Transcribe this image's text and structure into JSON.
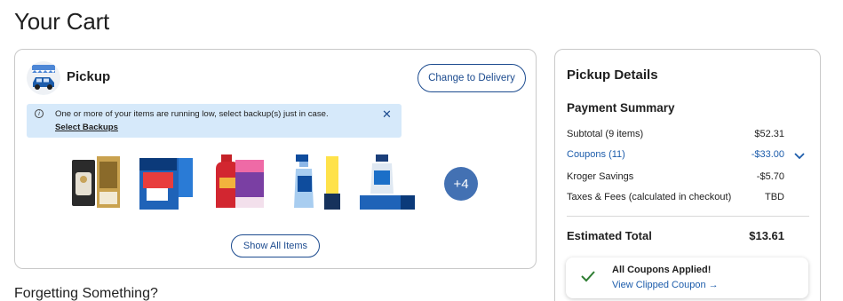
{
  "page": {
    "title": "Your Cart"
  },
  "pickup": {
    "title": "Pickup",
    "change_button": "Change to Delivery",
    "alert": {
      "message": "One or more of your items are running low, select backup(s) just in case.",
      "link": "Select Backups"
    },
    "products": [
      {
        "name": "Air Wick Advanced Warmer",
        "label": "ADVANCED WARMER"
      },
      {
        "name": "Finish Power dishwasher tabs",
        "label": "POWER"
      },
      {
        "name": "Softsoap Energizing body wash",
        "label": "Energizing"
      },
      {
        "name": "Dawn Powerwash spray",
        "label": "Lemon Scent"
      },
      {
        "name": "Dawn Powerwash refill",
        "label": "Fresh Rain Scent"
      }
    ],
    "more_count": "+4",
    "show_all_button": "Show All Items"
  },
  "details": {
    "title": "Pickup Details",
    "summary_title": "Payment Summary",
    "rows": [
      {
        "label": "Subtotal (9 items)",
        "value": "$52.31"
      },
      {
        "label": "Coupons (11)",
        "value": "-$33.00"
      },
      {
        "label": "Kroger Savings",
        "value": "-$5.70"
      },
      {
        "label": "Taxes & Fees (calculated in checkout)",
        "value": "TBD"
      }
    ],
    "estimated_label": "Estimated Total",
    "estimated_value": "$13.61",
    "coupon_box": {
      "applied": "All Coupons Applied!",
      "view_link": "View Clipped Coupon"
    }
  },
  "forgetting": {
    "heading": "Forgetting Something?"
  },
  "colors": {
    "accent": "#1c4b8f",
    "link": "#1c5cab",
    "badge": "#4371b3",
    "alert_bg": "#d6e9fa"
  }
}
